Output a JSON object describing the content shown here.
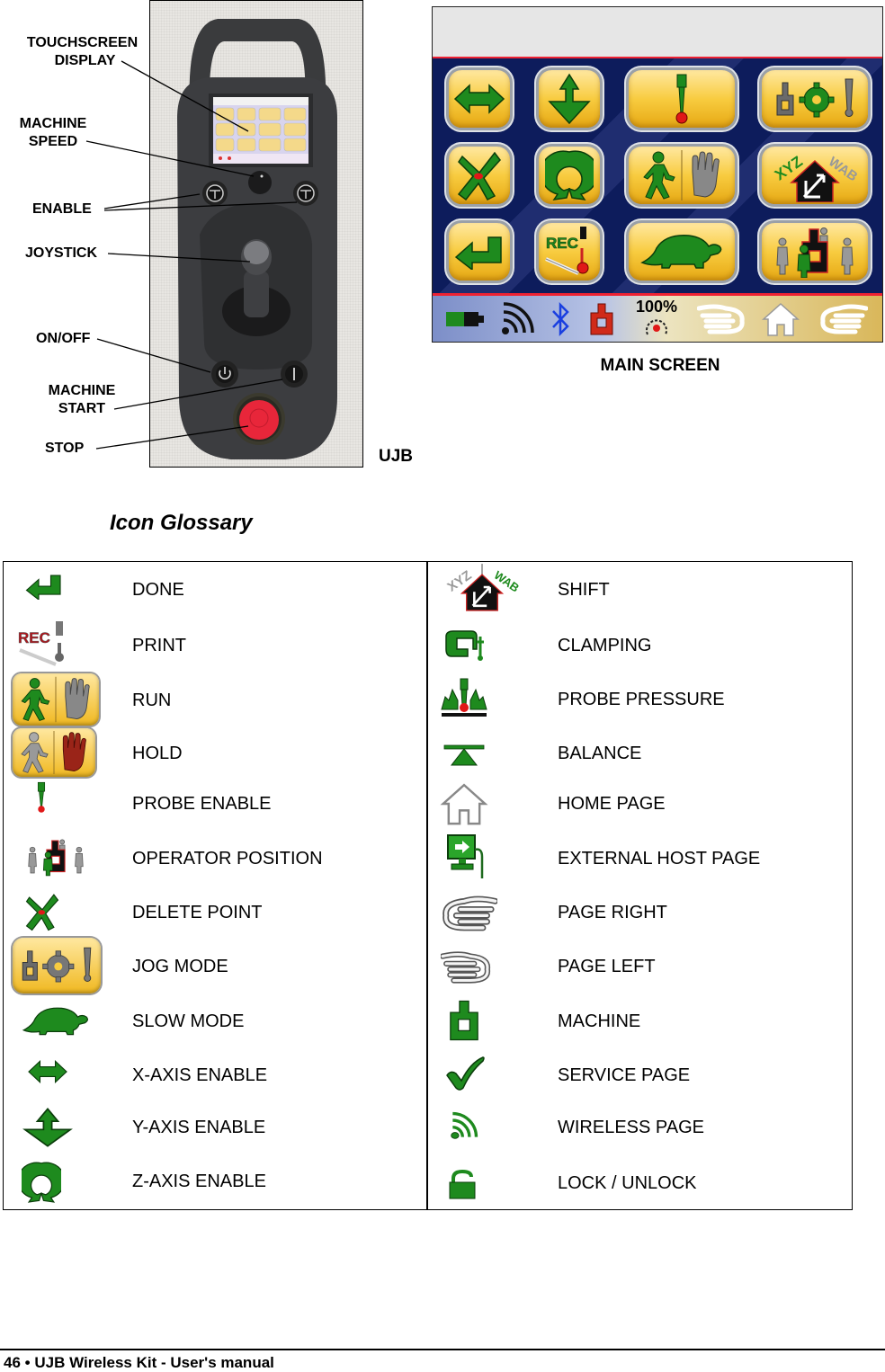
{
  "callouts": {
    "touchscreen_display": [
      "TOUCHSCREEN",
      "DISPLAY"
    ],
    "machine_speed": [
      "MACHINE",
      "SPEED"
    ],
    "enable": "ENABLE",
    "joystick": "JOYSTICK",
    "on_off": "ON/OFF",
    "machine_start": [
      "MACHINE",
      "START"
    ],
    "stop": "STOP",
    "device_caption": "UJB"
  },
  "main_screen": {
    "caption": "MAIN SCREEN",
    "tiles": [
      {
        "icon": "x-axis-enable-icon"
      },
      {
        "icon": "y-axis-enable-icon"
      },
      {
        "icon": "probe-enable-icon"
      },
      {
        "icon": "jog-mode-icon"
      },
      {
        "icon": "delete-point-icon"
      },
      {
        "icon": "z-axis-enable-icon"
      },
      {
        "icon": "run-hold-icon"
      },
      {
        "icon": "shift-icon"
      },
      {
        "icon": "done-icon"
      },
      {
        "icon": "print-rec-icon",
        "text": "REC"
      },
      {
        "icon": "slow-mode-icon"
      },
      {
        "icon": "operator-position-icon"
      }
    ],
    "status_bar": {
      "battery": "battery-icon",
      "wireless": "wireless-icon",
      "bluetooth": "bluetooth-icon",
      "machine": "machine-icon",
      "speed_percent": "100%",
      "page_left": "page-left-icon",
      "home": "home-icon",
      "page_right": "page-right-icon"
    },
    "colors": {
      "tile": "#f8cc40",
      "background": "#0d1c5c",
      "accent_line": "#e22233",
      "icon_green": "#1e8a1e"
    }
  },
  "glossary": {
    "title": "Icon Glossary",
    "left": [
      {
        "label": "DONE",
        "icon": "done-icon"
      },
      {
        "label": "PRINT",
        "icon": "print-rec-icon"
      },
      {
        "label": "RUN",
        "icon": "run-icon"
      },
      {
        "label": "HOLD",
        "icon": "hold-icon"
      },
      {
        "label": "PROBE ENABLE",
        "icon": "probe-enable-icon"
      },
      {
        "label": "OPERATOR POSITION",
        "icon": "operator-position-icon"
      },
      {
        "label": "DELETE POINT",
        "icon": "delete-point-icon"
      },
      {
        "label": "JOG MODE",
        "icon": "jog-mode-icon"
      },
      {
        "label": "SLOW MODE",
        "icon": "slow-mode-icon"
      },
      {
        "label": "X-AXIS ENABLE",
        "icon": "x-axis-enable-icon"
      },
      {
        "label": "Y-AXIS ENABLE",
        "icon": "y-axis-enable-icon"
      },
      {
        "label": "Z-AXIS ENABLE",
        "icon": "z-axis-enable-icon"
      }
    ],
    "right": [
      {
        "label": "SHIFT",
        "icon": "shift-icon"
      },
      {
        "label": "CLAMPING",
        "icon": "clamping-icon"
      },
      {
        "label": "PROBE PRESSURE",
        "icon": "probe-pressure-icon"
      },
      {
        "label": "BALANCE",
        "icon": "balance-icon"
      },
      {
        "label": "HOME PAGE",
        "icon": "home-icon"
      },
      {
        "label": "EXTERNAL HOST PAGE",
        "icon": "external-host-icon"
      },
      {
        "label": "PAGE RIGHT",
        "icon": "page-right-icon"
      },
      {
        "label": "PAGE LEFT",
        "icon": "page-left-icon"
      },
      {
        "label": "MACHINE",
        "icon": "machine-icon"
      },
      {
        "label": "SERVICE PAGE",
        "icon": "checkmark-icon"
      },
      {
        "label": "WIRELESS PAGE",
        "icon": "wireless-icon"
      },
      {
        "label": "LOCK / UNLOCK",
        "icon": "lock-icon"
      }
    ]
  },
  "footer": {
    "page_number": "46",
    "bullet": "•",
    "title": "UJB Wireless Kit - User's manual"
  }
}
